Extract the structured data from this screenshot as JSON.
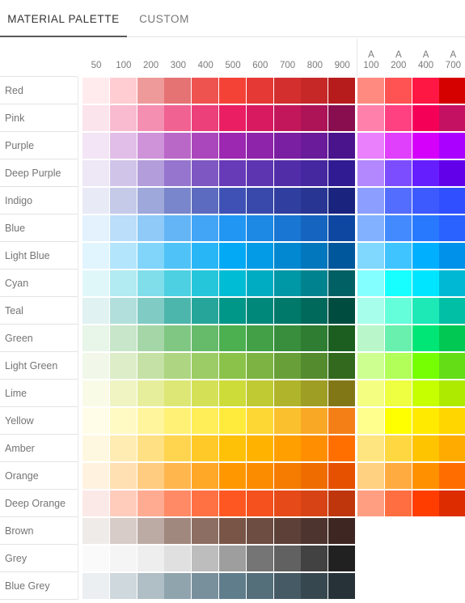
{
  "tabs": [
    {
      "id": "material",
      "label": "MATERIAL PALETTE",
      "active": true
    },
    {
      "id": "custom",
      "label": "CUSTOM",
      "active": false
    }
  ],
  "grid": {
    "columns": [
      {
        "label": "50",
        "accent": false
      },
      {
        "label": "100",
        "accent": false
      },
      {
        "label": "200",
        "accent": false
      },
      {
        "label": "300",
        "accent": false
      },
      {
        "label": "400",
        "accent": false
      },
      {
        "label": "500",
        "accent": false
      },
      {
        "label": "600",
        "accent": false
      },
      {
        "label": "700",
        "accent": false
      },
      {
        "label": "800",
        "accent": false
      },
      {
        "label": "900",
        "accent": false
      },
      {
        "label": "100",
        "accent": true,
        "prefix": "A"
      },
      {
        "label": "200",
        "accent": true,
        "prefix": "A"
      },
      {
        "label": "400",
        "accent": true,
        "prefix": "A"
      },
      {
        "label": "700",
        "accent": true,
        "prefix": "A"
      }
    ],
    "rows": [
      {
        "name": "Red",
        "swatches": [
          "#FFEBEE",
          "#FFCDD2",
          "#EF9A9A",
          "#E57373",
          "#EF5350",
          "#F44336",
          "#E53935",
          "#D32F2F",
          "#C62828",
          "#B71C1C",
          "#FF8A80",
          "#FF5252",
          "#FF1744",
          "#D50000"
        ]
      },
      {
        "name": "Pink",
        "swatches": [
          "#FCE4EC",
          "#F8BBD0",
          "#F48FB1",
          "#F06292",
          "#EC407A",
          "#E91E63",
          "#D81B60",
          "#C2185B",
          "#AD1457",
          "#880E4F",
          "#FF80AB",
          "#FF4081",
          "#F50057",
          "#C51162"
        ]
      },
      {
        "name": "Purple",
        "swatches": [
          "#F3E5F5",
          "#E1BEE7",
          "#CE93D8",
          "#BA68C8",
          "#AB47BC",
          "#9C27B0",
          "#8E24AA",
          "#7B1FA2",
          "#6A1B9A",
          "#4A148C",
          "#EA80FC",
          "#E040FB",
          "#D500F9",
          "#AA00FF"
        ]
      },
      {
        "name": "Deep Purple",
        "swatches": [
          "#EDE7F6",
          "#D1C4E9",
          "#B39DDB",
          "#9575CD",
          "#7E57C2",
          "#673AB7",
          "#5E35B1",
          "#512DA8",
          "#4527A0",
          "#311B92",
          "#B388FF",
          "#7C4DFF",
          "#651FFF",
          "#6200EA"
        ]
      },
      {
        "name": "Indigo",
        "swatches": [
          "#E8EAF6",
          "#C5CAE9",
          "#9FA8DA",
          "#7986CB",
          "#5C6BC0",
          "#3F51B5",
          "#3949AB",
          "#303F9F",
          "#283593",
          "#1A237E",
          "#8C9EFF",
          "#536DFE",
          "#3D5AFE",
          "#304FFE"
        ]
      },
      {
        "name": "Blue",
        "swatches": [
          "#E3F2FD",
          "#BBDEFB",
          "#90CAF9",
          "#64B5F6",
          "#42A5F5",
          "#2196F3",
          "#1E88E5",
          "#1976D2",
          "#1565C0",
          "#0D47A1",
          "#82B1FF",
          "#448AFF",
          "#2979FF",
          "#2962FF"
        ]
      },
      {
        "name": "Light Blue",
        "swatches": [
          "#E1F5FE",
          "#B3E5FC",
          "#81D4FA",
          "#4FC3F7",
          "#29B6F6",
          "#03A9F4",
          "#039BE5",
          "#0288D1",
          "#0277BD",
          "#01579B",
          "#80D8FF",
          "#40C4FF",
          "#00B0FF",
          "#0091EA"
        ]
      },
      {
        "name": "Cyan",
        "swatches": [
          "#E0F7FA",
          "#B2EBF2",
          "#80DEEA",
          "#4DD0E1",
          "#26C6DA",
          "#00BCD4",
          "#00ACC1",
          "#0097A7",
          "#00838F",
          "#006064",
          "#84FFFF",
          "#18FFFF",
          "#00E5FF",
          "#00B8D4"
        ]
      },
      {
        "name": "Teal",
        "swatches": [
          "#E0F2F1",
          "#B2DFDB",
          "#80CBC4",
          "#4DB6AC",
          "#26A69A",
          "#009688",
          "#00897B",
          "#00796B",
          "#00695C",
          "#004D40",
          "#A7FFEB",
          "#64FFDA",
          "#1DE9B6",
          "#00BFA5"
        ]
      },
      {
        "name": "Green",
        "swatches": [
          "#E8F5E9",
          "#C8E6C9",
          "#A5D6A7",
          "#81C784",
          "#66BB6A",
          "#4CAF50",
          "#43A047",
          "#388E3C",
          "#2E7D32",
          "#1B5E20",
          "#B9F6CA",
          "#69F0AE",
          "#00E676",
          "#00C853"
        ]
      },
      {
        "name": "Light Green",
        "swatches": [
          "#F1F8E9",
          "#DCEDC8",
          "#C5E1A5",
          "#AED581",
          "#9CCC65",
          "#8BC34A",
          "#7CB342",
          "#689F38",
          "#558B2F",
          "#33691E",
          "#CCFF90",
          "#B2FF59",
          "#76FF03",
          "#64DD17"
        ]
      },
      {
        "name": "Lime",
        "swatches": [
          "#F9FBE7",
          "#F0F4C3",
          "#E6EE9C",
          "#DCE775",
          "#D4E157",
          "#CDDC39",
          "#C0CA33",
          "#AFB42B",
          "#9E9D24",
          "#827717",
          "#F4FF81",
          "#EEFF41",
          "#C6FF00",
          "#AEEA00"
        ]
      },
      {
        "name": "Yellow",
        "swatches": [
          "#FFFDE7",
          "#FFF9C4",
          "#FFF59D",
          "#FFF176",
          "#FFEE58",
          "#FFEB3B",
          "#FDD835",
          "#FBC02D",
          "#F9A825",
          "#F57F17",
          "#FFFF8D",
          "#FFFF00",
          "#FFEA00",
          "#FFD600"
        ]
      },
      {
        "name": "Amber",
        "swatches": [
          "#FFF8E1",
          "#FFECB3",
          "#FFE082",
          "#FFD54F",
          "#FFCA28",
          "#FFC107",
          "#FFB300",
          "#FFA000",
          "#FF8F00",
          "#FF6F00",
          "#FFE57F",
          "#FFD740",
          "#FFC400",
          "#FFAB00"
        ]
      },
      {
        "name": "Orange",
        "swatches": [
          "#FFF3E0",
          "#FFE0B2",
          "#FFCC80",
          "#FFB74D",
          "#FFA726",
          "#FF9800",
          "#FB8C00",
          "#F57C00",
          "#EF6C00",
          "#E65100",
          "#FFD180",
          "#FFAB40",
          "#FF9100",
          "#FF6D00"
        ]
      },
      {
        "name": "Deep Orange",
        "swatches": [
          "#FBE9E7",
          "#FFCCBC",
          "#FFAB91",
          "#FF8A65",
          "#FF7043",
          "#FF5722",
          "#F4511E",
          "#E64A19",
          "#D84315",
          "#BF360C",
          "#FF9E80",
          "#FF6E40",
          "#FF3D00",
          "#DD2C00"
        ]
      },
      {
        "name": "Brown",
        "swatches": [
          "#EFEBE9",
          "#D7CCC8",
          "#BCAAA4",
          "#A1887F",
          "#8D6E63",
          "#795548",
          "#6D4C41",
          "#5D4037",
          "#4E342E",
          "#3E2723",
          null,
          null,
          null,
          null
        ]
      },
      {
        "name": "Grey",
        "swatches": [
          "#FAFAFA",
          "#F5F5F5",
          "#EEEEEE",
          "#E0E0E0",
          "#BDBDBD",
          "#9E9E9E",
          "#757575",
          "#616161",
          "#424242",
          "#212121",
          null,
          null,
          null,
          null
        ]
      },
      {
        "name": "Blue Grey",
        "swatches": [
          "#ECEFF1",
          "#CFD8DC",
          "#B0BEC5",
          "#90A4AE",
          "#78909C",
          "#607D8B",
          "#546E7A",
          "#455A64",
          "#37474F",
          "#263238",
          null,
          null,
          null,
          null
        ]
      }
    ]
  },
  "colors": {
    "active_tab_text": "#333333",
    "inactive_tab_text": "#777777",
    "tab_underline": "#5a5a5a",
    "row_label_text": "#757575",
    "column_header_text": "#7a7a7a",
    "divider": "#e3e3e3",
    "background": "#ffffff"
  }
}
